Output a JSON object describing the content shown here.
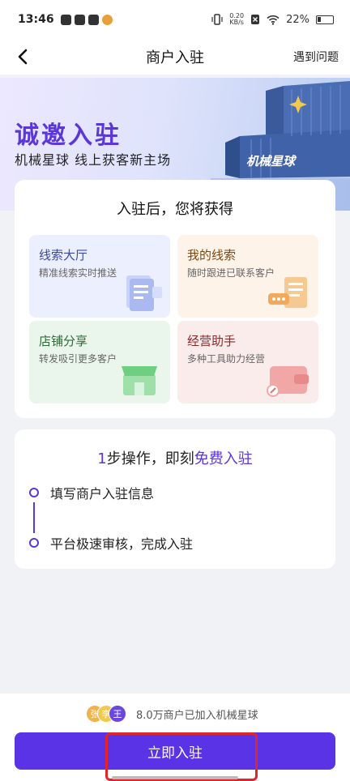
{
  "status_bar": {
    "time": "13:46",
    "net_speed_value": "0.20",
    "net_speed_unit": "KB/s",
    "battery": "22%"
  },
  "nav": {
    "title": "商户入驻",
    "help_link": "遇到问题"
  },
  "banner": {
    "title": "诚邀入驻",
    "subtitle": "机械星球 线上获客新主场",
    "brand_sign": "机械星球"
  },
  "benefits": {
    "title": "入驻后，您将获得",
    "items": [
      {
        "title": "线索大厅",
        "desc": "精准线索实时推送"
      },
      {
        "title": "我的线索",
        "desc": "随时跟进已联系客户"
      },
      {
        "title": "店铺分享",
        "desc": "转发吸引更多客户"
      },
      {
        "title": "经营助手",
        "desc": "多种工具助力经营"
      }
    ]
  },
  "steps": {
    "heading_prefix": "1",
    "heading_mid": "步操作，即刻",
    "heading_highlight": "免费入驻",
    "items": [
      "填写商户入驻信息",
      "平台极速审核，完成入驻"
    ]
  },
  "bottom": {
    "avatar_chars": [
      "张",
      "李",
      "王"
    ],
    "joined_text": "8.0万商户已加入机械星球",
    "join_button": "立即入驻"
  },
  "colors": {
    "accent": "#5a33e6",
    "highlight_box": "#e0262a"
  }
}
